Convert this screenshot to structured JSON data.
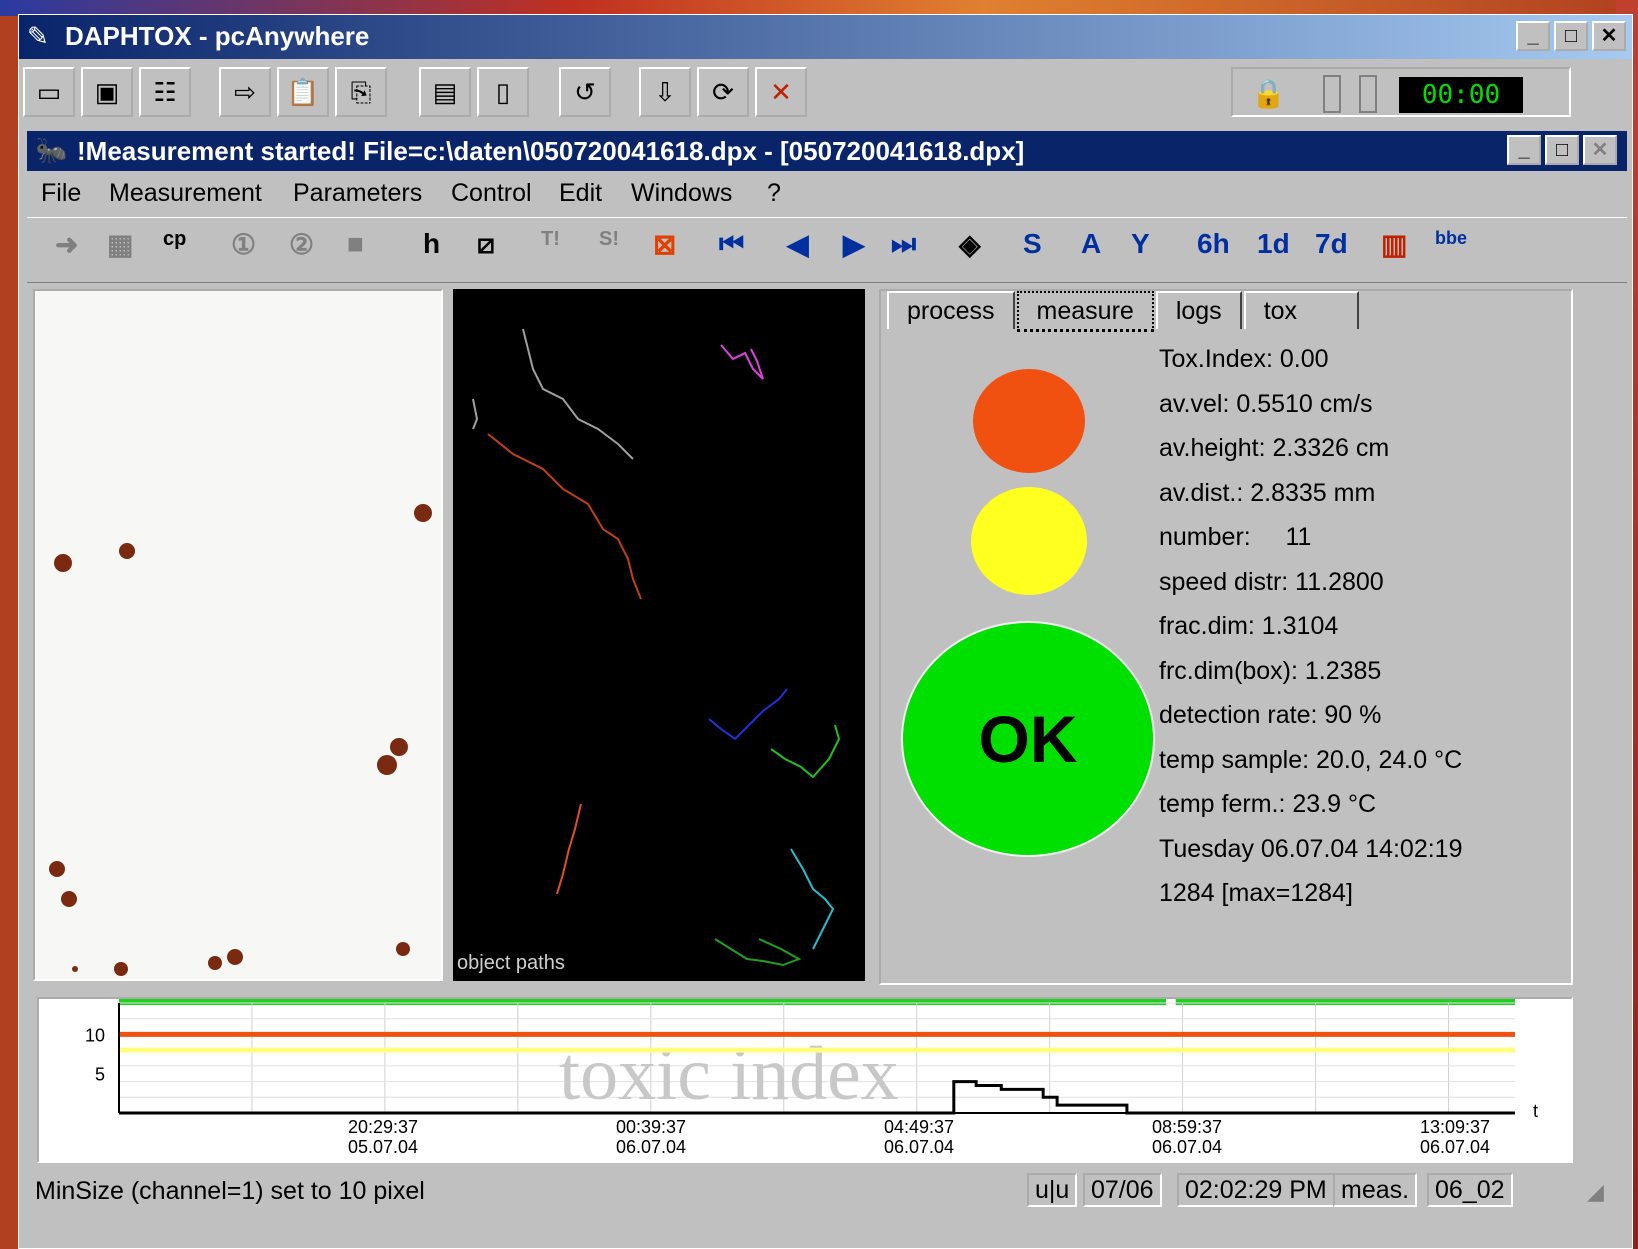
{
  "window": {
    "title": "DAPHTOX - pcAnywhere",
    "minimize": "_",
    "maximize": "□",
    "close": "✕"
  },
  "toolbar": {
    "icons": [
      "window-icon",
      "screen-icon",
      "properties-icon",
      "transfer-icon",
      "clipboard-icon",
      "files-icon",
      "display-icon",
      "document-icon",
      "link-icon",
      "connect-icon",
      "sync-icon",
      "end-session-icon"
    ],
    "timer": "00:00"
  },
  "child": {
    "title": "!Measurement started! File=c:\\daten\\050720041618.dpx - [050720041618.dpx]"
  },
  "menu": [
    "File",
    "Measurement",
    "Parameters",
    "Control",
    "Edit",
    "Windows",
    "?"
  ],
  "toolbar2": {
    "s": "S",
    "a": "A",
    "y": "Y",
    "h6": "6h",
    "d1": "1d",
    "d7": "7d",
    "t": "T!",
    "s2": "S!",
    "bbe": "bbe"
  },
  "paths_label": "object paths",
  "tabs": [
    {
      "label": "process"
    },
    {
      "label": "measure",
      "active": true
    },
    {
      "label": "logs"
    },
    {
      "label": "tox"
    }
  ],
  "stats": [
    "Tox.Index: 0.00",
    "av.vel: 0.5510 cm/s",
    "av.height: 2.3326 cm",
    "av.dist.:  2.8335 mm",
    "number:     11",
    "speed distr: 11.2800",
    "frac.dim: 1.3104",
    "frc.dim(box):  1.2385",
    "detection rate:  90 %",
    "temp sample:  20.0, 24.0 °C",
    "temp ferm.:  23.9 °C",
    "Tuesday 06.07.04 14:02:19",
    "1284 [max=1284]"
  ],
  "traffic_light": {
    "red": "#f05010",
    "yellow": "#ffff20",
    "green": "#00e000",
    "ok_label": "OK"
  },
  "chart_data": {
    "type": "line",
    "watermark": "toxic index",
    "y_ticks": [
      10,
      5
    ],
    "x_axis_label": "t",
    "x_ticks": [
      {
        "time": "20:29:37",
        "date": "05.07.04"
      },
      {
        "time": "00:39:37",
        "date": "06.07.04"
      },
      {
        "time": "04:49:37",
        "date": "06.07.04"
      },
      {
        "time": "08:59:37",
        "date": "06.07.04"
      },
      {
        "time": "13:09:37",
        "date": "06.07.04"
      }
    ],
    "thresholds": [
      {
        "value": 10,
        "color": "#f05010"
      },
      {
        "value": 8,
        "color": "#ffff80"
      }
    ],
    "ylim": [
      0,
      14
    ],
    "series": [
      {
        "color": "#000000",
        "x": [
          0,
          0.598,
          0.598,
          0.614,
          0.614,
          0.632,
          0.632,
          0.662,
          0.662,
          0.672,
          0.672,
          0.722,
          0.722,
          1.0
        ],
        "y": [
          0,
          0,
          4,
          4,
          3.5,
          3.5,
          3,
          3,
          2,
          2,
          1,
          1,
          0,
          0
        ]
      }
    ]
  },
  "statusbar": {
    "text": "MinSize (channel=1) set to 10 pixel",
    "panels": [
      "u|u",
      "07/06",
      "02:02:29 PM",
      "meas.",
      "06_02"
    ]
  }
}
